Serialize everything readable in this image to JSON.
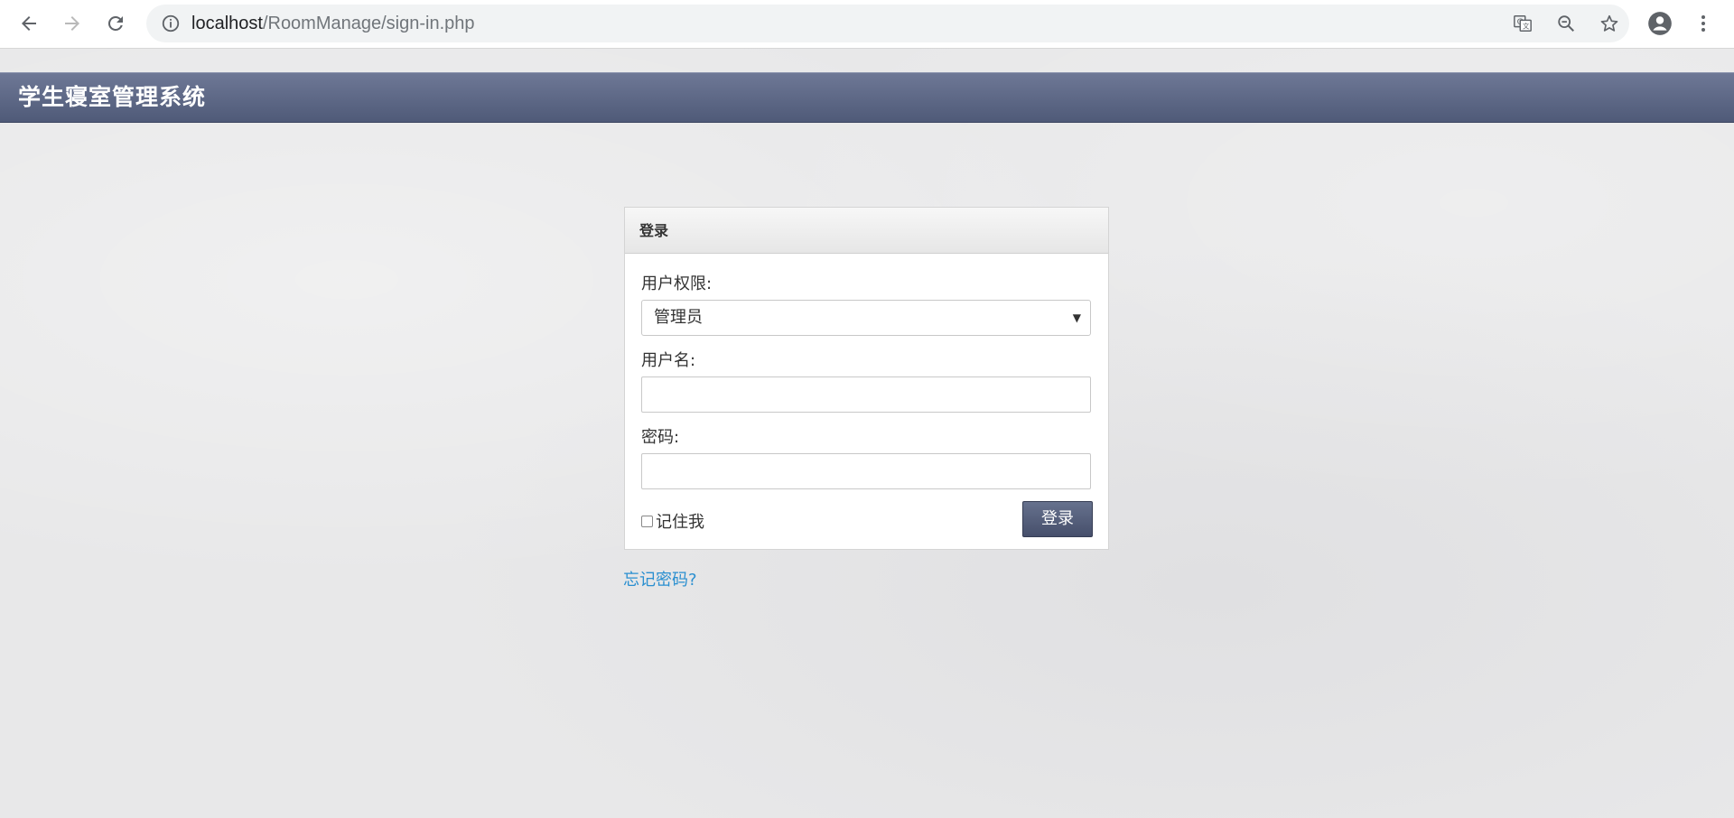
{
  "browser": {
    "url_host": "localhost",
    "url_path": "/RoomManage/sign-in.php",
    "icons": [
      "back-arrow-icon",
      "forward-arrow-icon",
      "reload-icon",
      "info-icon",
      "translate-icon",
      "zoom-icon",
      "star-icon",
      "account-icon",
      "menu-icon"
    ]
  },
  "app": {
    "title": "学生寝室管理系统"
  },
  "login": {
    "heading": "登录",
    "role_label": "用户权限:",
    "role_selected": "管理员",
    "username_label": "用户名:",
    "username_value": "",
    "password_label": "密码:",
    "password_value": "",
    "remember_label": "记住我",
    "submit_label": "登录",
    "forgot_label": "忘记密码?"
  },
  "colors": {
    "header_top": "#6e7896",
    "header_bottom": "#4f5a78",
    "button": "#4f5a78",
    "link": "#2a8fd0"
  }
}
